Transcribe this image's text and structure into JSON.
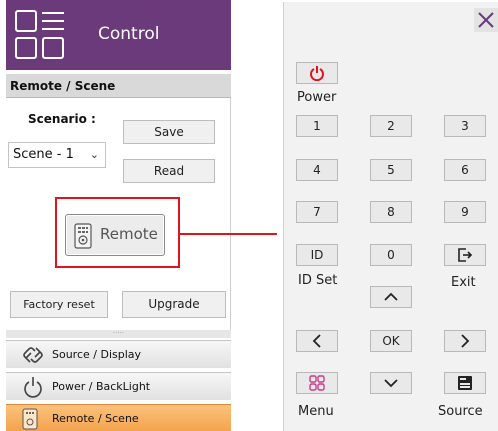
{
  "header": {
    "title": "Control",
    "menu_icon": "grid-menu-icon"
  },
  "section": {
    "title": "Remote / Scene"
  },
  "scenario": {
    "label": "Scenario :",
    "selected": "Scene - 1",
    "save_label": "Save",
    "read_label": "Read"
  },
  "remote_button": {
    "label": "Remote",
    "icon": "remote-control-icon"
  },
  "actions": {
    "factory_reset": "Factory reset",
    "upgrade": "Upgrade"
  },
  "nav": [
    {
      "label": "Source / Display",
      "icon": "link-icon"
    },
    {
      "label": "Power / BackLight",
      "icon": "power-icon"
    },
    {
      "label": "Remote / Scene",
      "icon": "remote-control-icon",
      "active": true
    }
  ],
  "colors": {
    "header": "#6b3a7b",
    "highlight": "#e0141e",
    "active_nav": "#f4a24c",
    "power": "#e0141e",
    "menu_icon": "#c93c8c"
  },
  "remote": {
    "power_label": "Power",
    "keys": [
      "1",
      "2",
      "3",
      "4",
      "5",
      "6",
      "7",
      "8",
      "9",
      "ID",
      "0"
    ],
    "id_set_label": "ID Set",
    "exit_label": "Exit",
    "ok_label": "OK",
    "menu_label": "Menu",
    "source_label": "Source",
    "icons": [
      "power-icon",
      "exit-icon",
      "chevron-up-icon",
      "chevron-left-icon",
      "chevron-right-icon",
      "chevron-down-icon",
      "menu-grid-icon",
      "source-icon",
      "close-icon"
    ]
  }
}
